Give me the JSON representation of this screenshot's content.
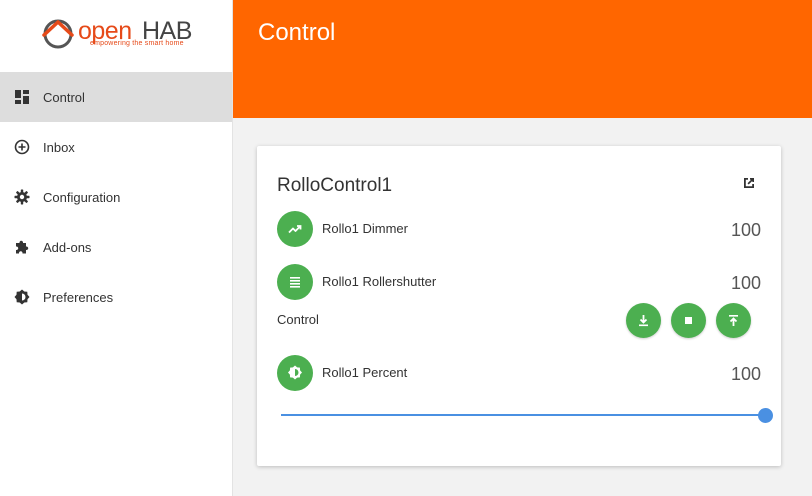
{
  "brand": {
    "name_open": "open",
    "name_hab": "HAB",
    "tagline": "empowering the smart home"
  },
  "sidebar": {
    "items": [
      {
        "label": "Control",
        "icon": "dashboard-icon",
        "active": true
      },
      {
        "label": "Inbox",
        "icon": "add-circle-icon",
        "active": false
      },
      {
        "label": "Configuration",
        "icon": "gear-icon",
        "active": false
      },
      {
        "label": "Add-ons",
        "icon": "puzzle-icon",
        "active": false
      },
      {
        "label": "Preferences",
        "icon": "brightness-icon",
        "active": false
      }
    ]
  },
  "header": {
    "title": "Control"
  },
  "colors": {
    "accent": "#ff6600",
    "green": "#4caf50",
    "slider": "#4a90e2"
  },
  "card": {
    "title": "RolloControl1",
    "items": [
      {
        "label": "Rollo1 Dimmer",
        "value": "100",
        "icon": "trending-up-icon"
      },
      {
        "label": "Rollo1 Rollershutter",
        "value": "100",
        "icon": "blinds-icon"
      },
      {
        "label": "Rollo1 Percent",
        "value": "100",
        "icon": "brightness-icon"
      }
    ],
    "control": {
      "label": "Control",
      "buttons": [
        "download-icon",
        "stop-icon",
        "upload-icon"
      ]
    },
    "slider": {
      "value": 100,
      "min": 0,
      "max": 100
    }
  }
}
